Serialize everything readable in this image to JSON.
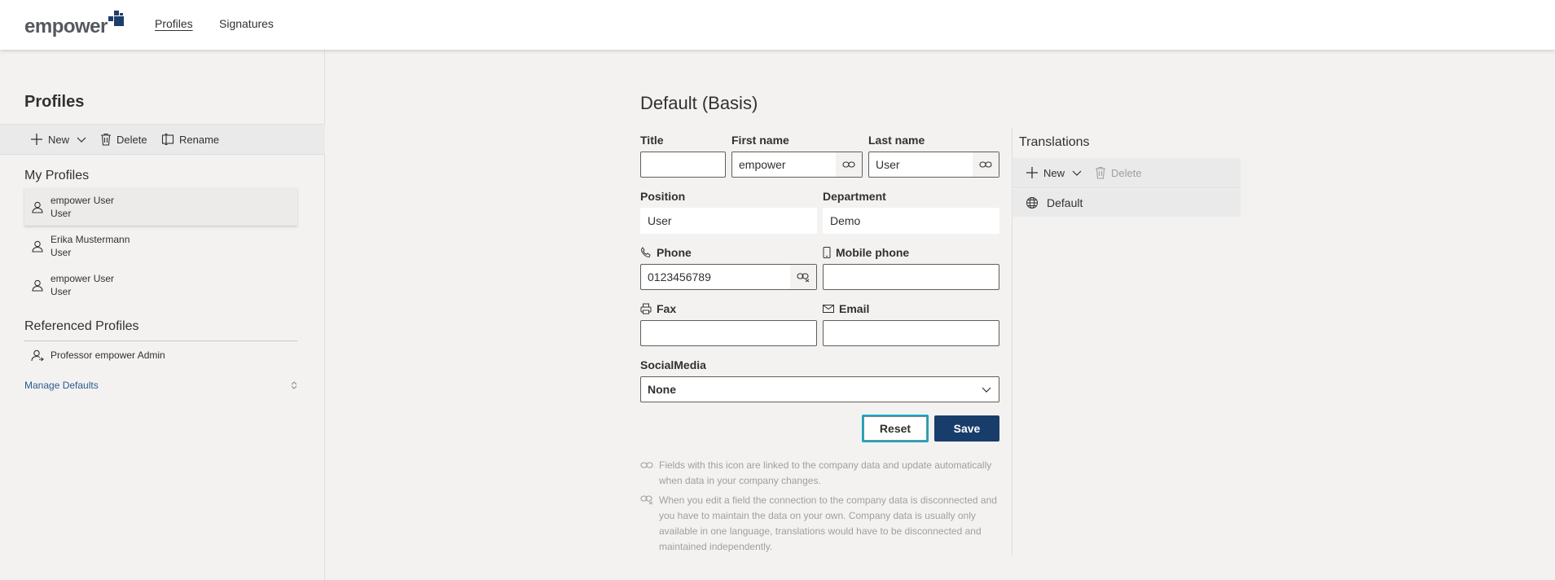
{
  "app": {
    "logo_text": "empower",
    "nav": [
      {
        "label": "Profiles",
        "active": true
      },
      {
        "label": "Signatures",
        "active": false
      }
    ]
  },
  "sidebar": {
    "title": "Profiles",
    "commands": {
      "new": "New",
      "delete": "Delete",
      "rename": "Rename"
    },
    "my_profiles_title": "My Profiles",
    "my_profiles": [
      {
        "name": "empower User",
        "role": "User",
        "selected": true
      },
      {
        "name": "Erika Mustermann",
        "role": "User",
        "selected": false
      },
      {
        "name": "empower User",
        "role": "User",
        "selected": false
      }
    ],
    "referenced_title": "Referenced Profiles",
    "referenced": [
      {
        "name": "Professor empower Admin"
      }
    ],
    "manage_defaults": "Manage Defaults"
  },
  "form": {
    "title": "Default (Basis)",
    "fields": {
      "title": {
        "label": "Title",
        "value": ""
      },
      "first_name": {
        "label": "First name",
        "value": "empower"
      },
      "last_name": {
        "label": "Last name",
        "value": "User"
      },
      "position": {
        "label": "Position",
        "value": "User"
      },
      "department": {
        "label": "Department",
        "value": "Demo"
      },
      "phone": {
        "label": "Phone",
        "value": "0123456789"
      },
      "mobile": {
        "label": "Mobile phone",
        "value": ""
      },
      "fax": {
        "label": "Fax",
        "value": ""
      },
      "email": {
        "label": "Email",
        "value": ""
      },
      "social": {
        "label": "SocialMedia",
        "value": "None"
      }
    },
    "buttons": {
      "reset": "Reset",
      "save": "Save"
    },
    "hints": [
      {
        "icon": "link-icon",
        "text": "Fields with this icon are linked to the company data and update automatically when data in your company changes."
      },
      {
        "icon": "unlink-icon",
        "text": "When you edit a field the connection to the company data is disconnected and you have to maintain the data on your own. Company data is usually only available in one language, translations would have to be disconnected and maintained independently."
      }
    ]
  },
  "translations": {
    "title": "Translations",
    "commands": {
      "new": "New",
      "delete": "Delete"
    },
    "items": [
      {
        "label": "Default"
      }
    ]
  },
  "colors": {
    "accent": "#183d6b",
    "focus_ring": "#00a8c8",
    "link": "#2b5a8e",
    "logo_blue": "#1e3d6b"
  }
}
